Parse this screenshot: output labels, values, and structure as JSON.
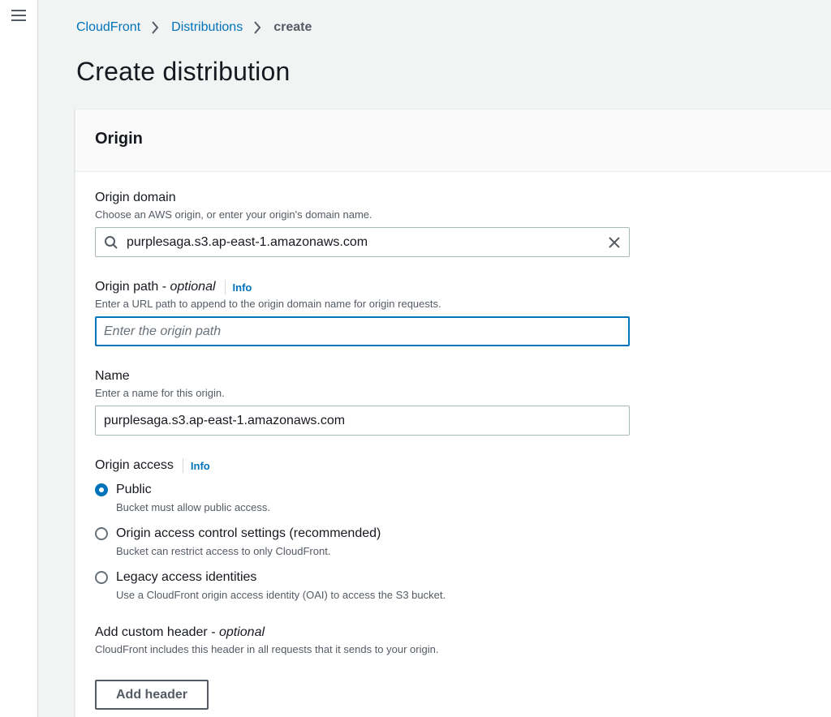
{
  "breadcrumb": {
    "items": [
      "CloudFront",
      "Distributions"
    ],
    "current": "create"
  },
  "page_title": "Create distribution",
  "origin_panel": {
    "title": "Origin",
    "origin_domain": {
      "label": "Origin domain",
      "description": "Choose an AWS origin, or enter your origin's domain name.",
      "value": "purplesaga.s3.ap-east-1.amazonaws.com"
    },
    "origin_path": {
      "label": "Origin path - ",
      "label_optional": "optional",
      "info": "Info",
      "description": "Enter a URL path to append to the origin domain name for origin requests.",
      "placeholder": "Enter the origin path"
    },
    "name": {
      "label": "Name",
      "description": "Enter a name for this origin.",
      "value": "purplesaga.s3.ap-east-1.amazonaws.com"
    },
    "origin_access": {
      "label": "Origin access",
      "info": "Info",
      "selected": "Public",
      "options": [
        {
          "label": "Public",
          "description": "Bucket must allow public access."
        },
        {
          "label": "Origin access control settings (recommended)",
          "description": "Bucket can restrict access to only CloudFront."
        },
        {
          "label": "Legacy access identities",
          "description": "Use a CloudFront origin access identity (OAI) to access the S3 bucket."
        }
      ]
    },
    "custom_header": {
      "label": "Add custom header - ",
      "label_optional": "optional",
      "description": "CloudFront includes this header in all requests that it sends to your origin.",
      "button": "Add header"
    }
  },
  "colors": {
    "accent": "#0073bb",
    "text": "#16191f",
    "secondary_text": "#545b64",
    "background": "#f2f3f3"
  }
}
